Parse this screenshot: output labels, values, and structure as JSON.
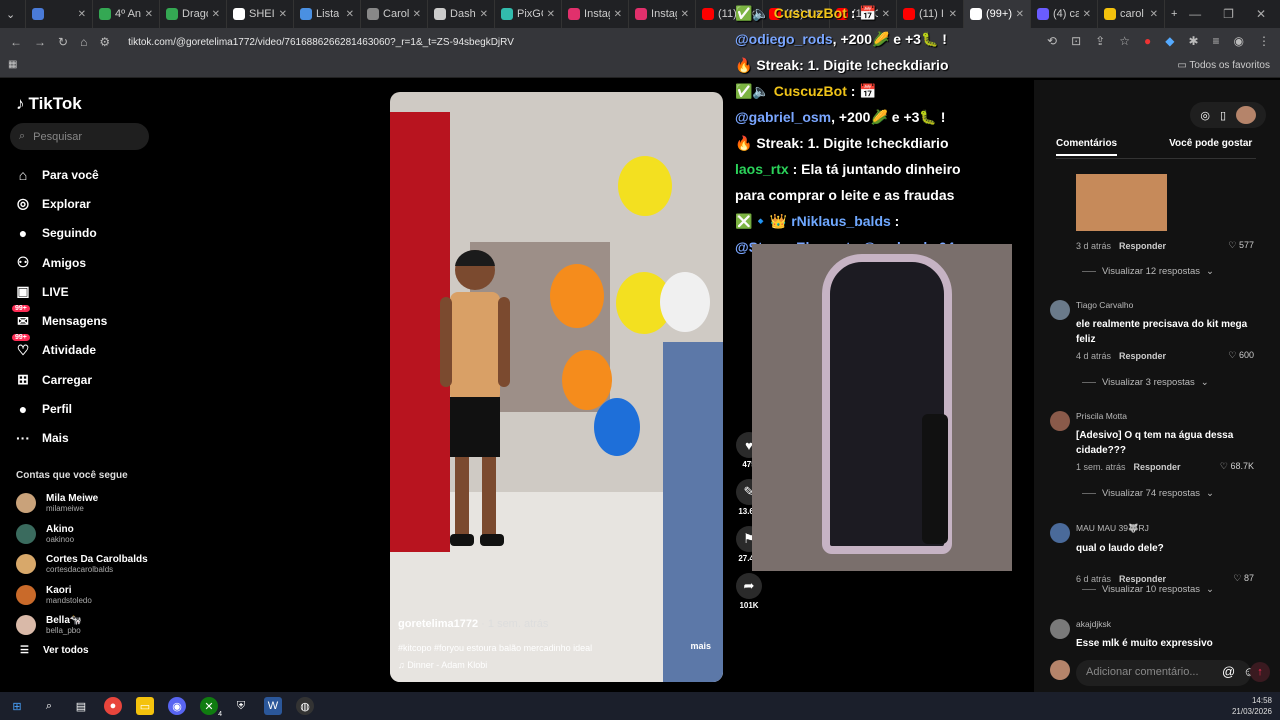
{
  "browser": {
    "tabs": [
      {
        "label": "",
        "color": "#4a7bd8"
      },
      {
        "label": "4º An",
        "color": "#34a853"
      },
      {
        "label": "Drago",
        "color": "#34a853"
      },
      {
        "label": "SHEI",
        "color": "#ffffff"
      },
      {
        "label": "Lista",
        "color": "#4a90e2"
      },
      {
        "label": "Carol",
        "color": "#888888"
      },
      {
        "label": "Dash",
        "color": "#cccccc"
      },
      {
        "label": "PixGO",
        "color": "#32bcad"
      },
      {
        "label": "Instag",
        "color": "#e1306c"
      },
      {
        "label": "Instag",
        "color": "#e1306c"
      },
      {
        "label": "(11) B",
        "color": "#ff0000"
      },
      {
        "label": "(11) B",
        "color": "#ff0000"
      },
      {
        "label": "(11) C",
        "color": "#ff0000"
      },
      {
        "label": "(11) I",
        "color": "#ff0000"
      },
      {
        "label": "(99+)",
        "color": "#ffffff"
      },
      {
        "label": "(4) ca",
        "color": "#6a5cff"
      },
      {
        "label": "carol",
        "color": "#f4c20d"
      }
    ],
    "active_tab_index": 14,
    "url": "tiktok.com/@goretelima1772/video/7616886266281463060?_r=1&_t=ZS-94sbegkDjRV",
    "favorites_label": "Todos os favoritos"
  },
  "tiktok": {
    "brand": "TikTok",
    "search_placeholder": "Pesquisar",
    "nav": [
      {
        "label": "Para você",
        "icon": "home-icon",
        "glyph": "⌂"
      },
      {
        "label": "Explorar",
        "icon": "compass-icon",
        "glyph": "◎"
      },
      {
        "label": "Seguindo",
        "icon": "following-avatar-icon",
        "glyph": "●"
      },
      {
        "label": "Amigos",
        "icon": "friends-icon",
        "glyph": "⚇"
      },
      {
        "label": "LIVE",
        "icon": "live-icon",
        "glyph": "▣"
      },
      {
        "label": "Mensagens",
        "icon": "messages-icon",
        "glyph": "✉",
        "badge": "99+"
      },
      {
        "label": "Atividade",
        "icon": "activity-icon",
        "glyph": "♡",
        "badge": "99+"
      },
      {
        "label": "Carregar",
        "icon": "upload-icon",
        "glyph": "⊞"
      },
      {
        "label": "Perfil",
        "icon": "profile-avatar-icon",
        "glyph": "●"
      },
      {
        "label": "Mais",
        "icon": "more-icon",
        "glyph": "···"
      }
    ],
    "following_title": "Contas que você segue",
    "following": [
      {
        "name": "Mila Meiwe",
        "handle": "milameiwe",
        "color": "#c9a27a"
      },
      {
        "name": "Akino",
        "handle": "oakinoo",
        "color": "#3a6b5e"
      },
      {
        "name": "Cortes Da Carolbalds",
        "handle": "cortesdacarolbalds",
        "color": "#d8a86a"
      },
      {
        "name": "Kaori",
        "handle": "mandstoledo",
        "color": "#c96a2a"
      },
      {
        "name": "Bella🐄",
        "handle": "bella_pbo",
        "color": "#d9b9a8"
      }
    ],
    "see_all": "Ver todos"
  },
  "video": {
    "author": "goretelima1772",
    "time": "· 1 sem. atrás",
    "description": "#kitcopo #foryou estoura balão mercadinho ideal",
    "more": "mais",
    "music": "♫  Dinner - Adam Klobi",
    "actions": [
      {
        "icon": "heart-icon",
        "glyph": "♥",
        "count": "475"
      },
      {
        "icon": "comment-icon",
        "glyph": "✎",
        "count": "13.6K"
      },
      {
        "icon": "bookmark-icon",
        "glyph": "⚑",
        "count": "27.4K"
      },
      {
        "icon": "share-icon",
        "glyph": "➦",
        "count": "101K"
      }
    ]
  },
  "stream_overlay": {
    "chat": [
      {
        "type": "bot",
        "prefix": "✅🔈",
        "name": "CuscuzBot",
        "suffix": " : 📅"
      },
      {
        "type": "text",
        "mention": "@odiego_rods",
        "text": ", +200🌽 e +3🐛 !"
      },
      {
        "type": "plain",
        "text": "🔥 Streak: 1. Digite !checkdiario"
      },
      {
        "type": "bot",
        "prefix": "✅🔈",
        "name": "CuscuzBot",
        "suffix": " : 📅"
      },
      {
        "type": "text",
        "mention": "@gabriel_osm",
        "text": ", +200🌽 e +3🐛 !"
      },
      {
        "type": "plain",
        "text": "🔥 Streak: 1. Digite !checkdiario"
      },
      {
        "type": "laos",
        "name": "laos_rtx",
        "text": " : Ela tá juntando dinheiro"
      },
      {
        "type": "plain",
        "text": "para comprar o leite e as fraudas"
      },
      {
        "type": "nik",
        "prefix": "❎🔹👑 ",
        "name": "rNiklaus_balds",
        "text": " :"
      },
      {
        "type": "mentions",
        "text": "@StreamElements @pedrooka04"
      }
    ]
  },
  "comments": {
    "tabs": [
      "Comentários",
      "Você pode gostar"
    ],
    "items": [
      {
        "user": "",
        "text": "",
        "time": "3 d atrás",
        "reply": "Responder",
        "likes": "577",
        "view_more": "Visualizar 12 respostas",
        "avatar": "#c68a5a"
      },
      {
        "user": "Tiago Carvalho",
        "text": "ele realmente precisava do kit mega feliz",
        "time": "4 d atrás",
        "reply": "Responder",
        "likes": "600",
        "view_more": "Visualizar 3 respostas",
        "avatar": "#6a7a8a"
      },
      {
        "user": "Priscila Motta",
        "text": "[Adesivo] O q tem na água dessa cidade???",
        "time": "1 sem. atrás",
        "reply": "Responder",
        "likes": "68.7K",
        "view_more": "Visualizar 74 respostas",
        "avatar": "#8a5a4a"
      },
      {
        "user": "MAU MAU 39🐺RJ",
        "text": "qual o laudo dele?",
        "time": "6 d atrás",
        "reply": "Responder",
        "likes": "87",
        "view_more": "Visualizar 10 respostas",
        "avatar": "#4a6a9a"
      },
      {
        "user": "akajdjksk",
        "text": "Esse mlk é muito expressivo",
        "avatar": "#7a7a7a"
      }
    ],
    "input_placeholder": "Adicionar comentário..."
  },
  "taskbar": {
    "time": "14:58",
    "date": "21/03/2026",
    "xbox_badge": "4"
  }
}
